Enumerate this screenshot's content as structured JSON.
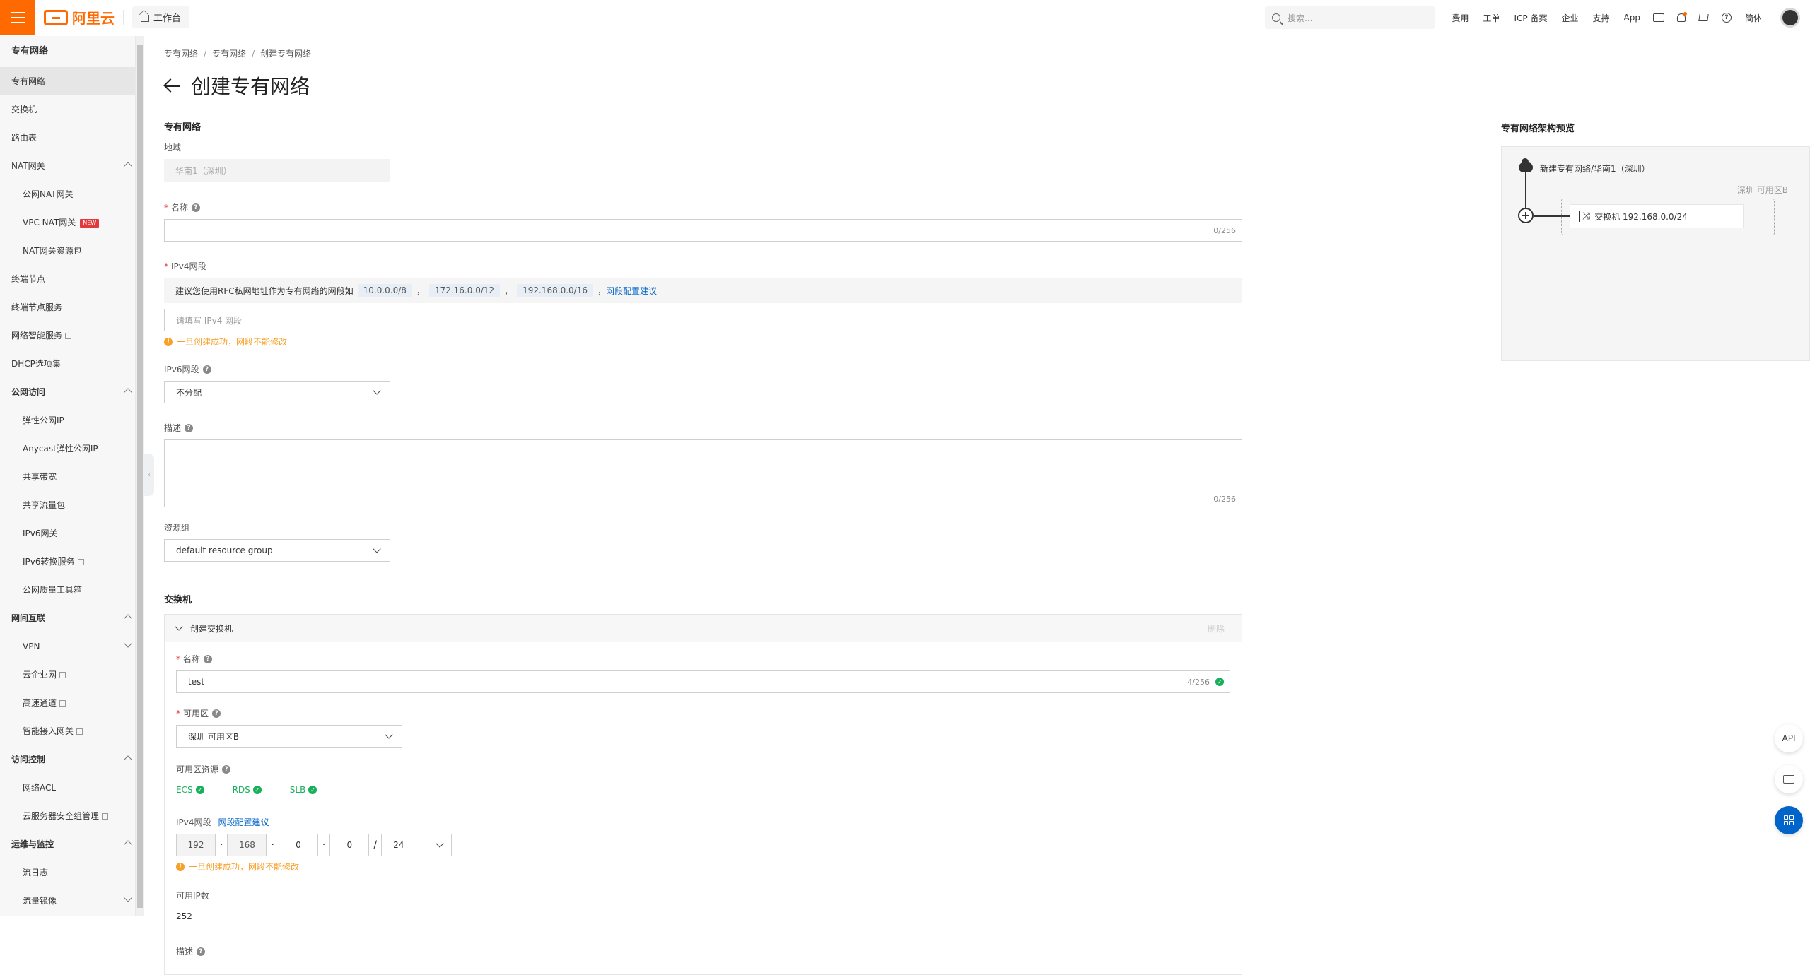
{
  "topbar": {
    "logo_text": "阿里云",
    "workbench_label": "工作台",
    "search_placeholder": "搜索...",
    "nav_items": [
      "费用",
      "工单",
      "ICP 备案",
      "企业",
      "支持",
      "App"
    ],
    "language": "简体"
  },
  "sidebar": {
    "title": "专有网络",
    "items": {
      "vpc": "专有网络",
      "vswitch": "交换机",
      "route_table": "路由表",
      "nat_gateway": "NAT网关",
      "public_nat": "公网NAT网关",
      "vpc_nat": "VPC NAT网关",
      "vpc_nat_badge": "NEW",
      "nat_package": "NAT网关资源包",
      "endpoint": "终端节点",
      "endpoint_service": "终端节点服务",
      "network_intel": "网络智能服务",
      "dhcp": "DHCP选项集",
      "public_access": "公网访问",
      "eip": "弹性公网IP",
      "anycast_eip": "Anycast弹性公网IP",
      "shared_bandwidth": "共享带宽",
      "shared_traffic": "共享流量包",
      "ipv6_gw": "IPv6网关",
      "ipv6_trans": "IPv6转换服务",
      "public_quality": "公网质量工具箱",
      "interconnect": "网间互联",
      "vpn": "VPN",
      "cen": "云企业网",
      "express": "高速通道",
      "smart_access": "智能接入网关",
      "access_control": "访问控制",
      "network_acl": "网络ACL",
      "security_group": "云服务器安全组管理",
      "ops_monitor": "运维与监控",
      "flow_log": "流日志",
      "traffic_mirror": "流量镜像"
    }
  },
  "breadcrumb": [
    "专有网络",
    "专有网络",
    "创建专有网络"
  ],
  "page_title": "创建专有网络",
  "vpc_form": {
    "section_title": "专有网络",
    "region_label": "地域",
    "region_value": "华南1（深圳）",
    "name_label": "名称",
    "name_counter": "0/256",
    "ipv4_label": "IPv4网段",
    "ipv4_notice_prefix": "建议您使用RFC私网地址作为专有网络的网段如",
    "ipv4_tags": [
      "10.0.0.0/8",
      "172.16.0.0/12",
      "192.168.0.0/16"
    ],
    "ipv4_sep": "，",
    "ipv4_suggest_link": "网段配置建议",
    "ipv4_placeholder": "请填写 IPv4 网段",
    "ipv4_warning": "一旦创建成功，网段不能修改",
    "ipv6_label": "IPv6网段",
    "ipv6_value": "不分配",
    "desc_label": "描述",
    "desc_counter": "0/256",
    "rg_label": "资源组",
    "rg_value": "default resource group"
  },
  "vswitch_form": {
    "section_title": "交换机",
    "panel_title": "创建交换机",
    "delete_label": "删除",
    "name_label": "名称",
    "name_value": "test",
    "name_counter": "4/256",
    "zone_label": "可用区",
    "zone_value": "深圳 可用区B",
    "zone_res_label": "可用区资源",
    "resources": [
      "ECS",
      "RDS",
      "SLB"
    ],
    "ipv4_label": "IPv4网段",
    "ipv4_link": "网段配置建议",
    "ip_octets": [
      "192",
      "168",
      "0",
      "0"
    ],
    "mask": "24",
    "ipv4_warning": "一旦创建成功，网段不能修改",
    "avail_ip_label": "可用IP数",
    "avail_ip_value": "252",
    "desc_label": "描述"
  },
  "preview": {
    "title": "专有网络架构预览",
    "vpc_label": "新建专有网络/华南1（深圳）",
    "zone_label": "深圳 可用区B",
    "switch_label": "交换机 192.168.0.0/24"
  },
  "floaters": {
    "api_label": "API"
  },
  "colors": {
    "brand": "#ff6a00",
    "link": "#0064c8",
    "success": "#1aaf5d",
    "warning": "#f7a12a"
  }
}
